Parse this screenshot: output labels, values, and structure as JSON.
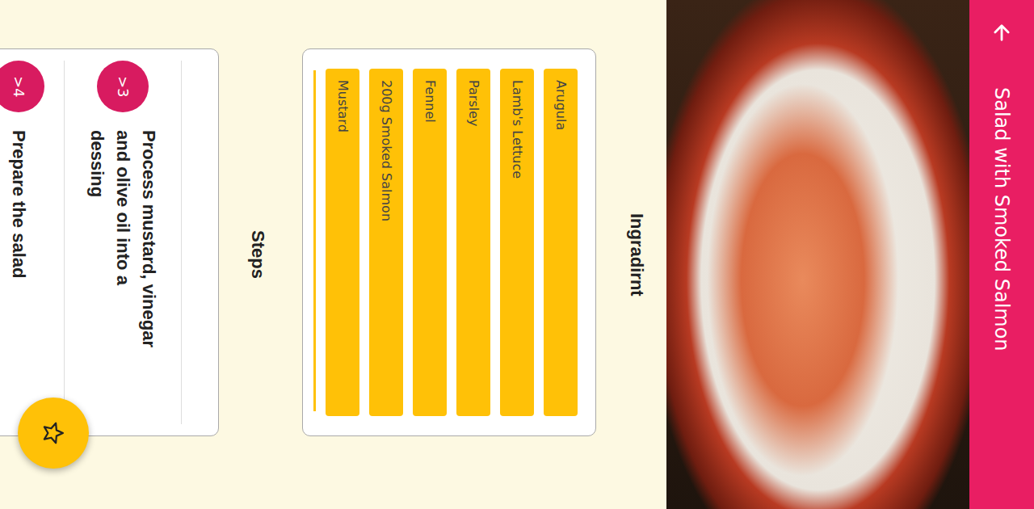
{
  "app_bar": {
    "title": "Salad with Smoked Salmon"
  },
  "ingredients": {
    "heading": "Ingradirnt",
    "items": [
      "Arugula",
      "Lamb's Lettuce",
      "Parsley",
      "Fennel",
      "200g Smoked Salmon",
      "Mustard"
    ]
  },
  "steps": {
    "heading": "Steps",
    "items": [
      {
        "number": ">3",
        "text": "Process mustard, vinegar and olive oil into a dessing"
      },
      {
        "number": ">4",
        "text": "Prepare the salad"
      }
    ]
  },
  "favorite": {
    "on": false
  }
}
